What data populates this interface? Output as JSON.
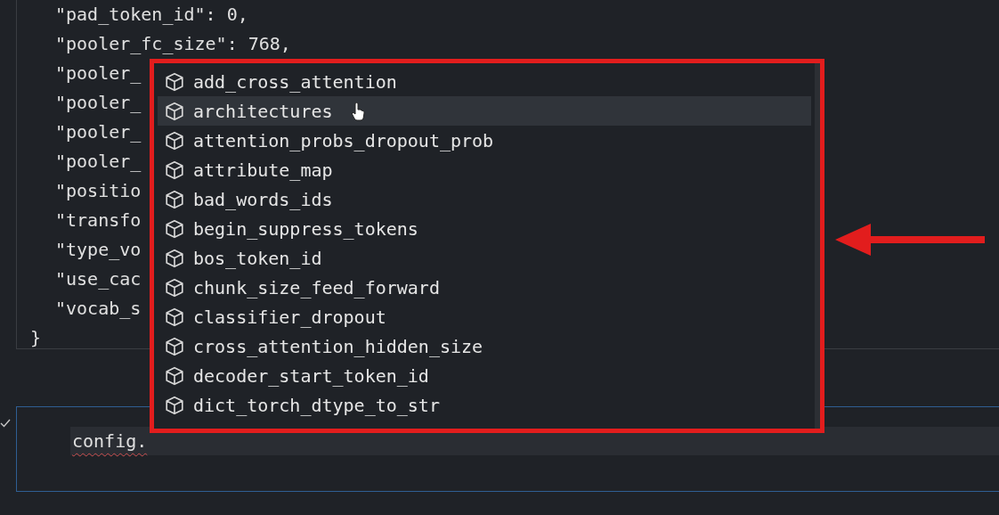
{
  "code_cell": {
    "lines": [
      "\"pad_token_id\": 0,",
      "\"pooler_fc_size\": 768,",
      "\"pooler_",
      "\"pooler_",
      "\"pooler_",
      "\"pooler_",
      "\"positio",
      "\"transfo",
      "\"type_vo",
      "\"use_cac",
      "\"vocab_s"
    ],
    "closing_brace": "}"
  },
  "input_cell": {
    "succeeded": true,
    "value": "config."
  },
  "suggestions": [
    {
      "label": "add_cross_attention",
      "selected": false
    },
    {
      "label": "architectures",
      "selected": true
    },
    {
      "label": "attention_probs_dropout_prob",
      "selected": false
    },
    {
      "label": "attribute_map",
      "selected": false
    },
    {
      "label": "bad_words_ids",
      "selected": false
    },
    {
      "label": "begin_suppress_tokens",
      "selected": false
    },
    {
      "label": "bos_token_id",
      "selected": false
    },
    {
      "label": "chunk_size_feed_forward",
      "selected": false
    },
    {
      "label": "classifier_dropout",
      "selected": false
    },
    {
      "label": "cross_attention_hidden_size",
      "selected": false
    },
    {
      "label": "decoder_start_token_id",
      "selected": false
    },
    {
      "label": "dict_torch_dtype_to_str",
      "selected": false
    }
  ]
}
